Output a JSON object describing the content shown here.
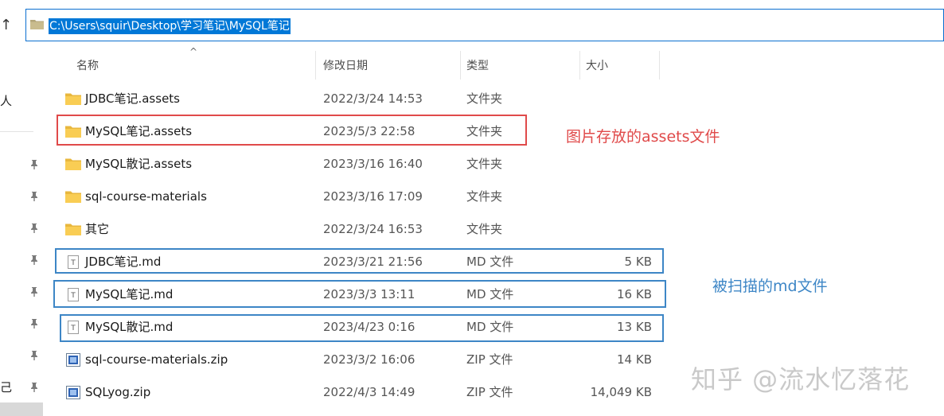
{
  "address_bar": {
    "path": "C:\\Users\\squir\\Desktop\\学习笔记\\MySQL笔记"
  },
  "left_nav": {
    "label_top": "人",
    "label_bottom": "己"
  },
  "columns": {
    "name": "名称",
    "modified": "修改日期",
    "type": "类型",
    "size": "大小"
  },
  "files": [
    {
      "name": "JDBC笔记.assets",
      "modified": "2022/3/24 14:53",
      "type": "文件夹",
      "size": "",
      "icon": "folder-icon"
    },
    {
      "name": "MySQL笔记.assets",
      "modified": "2023/5/3 22:58",
      "type": "文件夹",
      "size": "",
      "icon": "folder-icon"
    },
    {
      "name": "MySQL散记.assets",
      "modified": "2023/3/16 16:40",
      "type": "文件夹",
      "size": "",
      "icon": "folder-icon"
    },
    {
      "name": "sql-course-materials",
      "modified": "2023/3/16 17:09",
      "type": "文件夹",
      "size": "",
      "icon": "folder-icon"
    },
    {
      "name": "其它",
      "modified": "2022/3/24 16:53",
      "type": "文件夹",
      "size": "",
      "icon": "folder-icon"
    },
    {
      "name": "JDBC笔记.md",
      "modified": "2023/3/21 21:56",
      "type": "MD 文件",
      "size": "5 KB",
      "icon": "text-file-icon"
    },
    {
      "name": "MySQL笔记.md",
      "modified": "2023/3/3 13:11",
      "type": "MD 文件",
      "size": "16 KB",
      "icon": "text-file-icon"
    },
    {
      "name": "MySQL散记.md",
      "modified": "2023/4/23 0:16",
      "type": "MD 文件",
      "size": "13 KB",
      "icon": "text-file-icon"
    },
    {
      "name": "sql-course-materials.zip",
      "modified": "2023/3/2 16:06",
      "type": "ZIP 文件",
      "size": "14 KB",
      "icon": "zip-file-icon"
    },
    {
      "name": "SQLyog.zip",
      "modified": "2022/4/3 14:49",
      "type": "ZIP 文件",
      "size": "14,049 KB",
      "icon": "zip-file-icon"
    }
  ],
  "annotations": {
    "red_note": "图片存放的assets文件",
    "blue_note": "被扫描的md文件",
    "red_color": "#e04a4a",
    "blue_color": "#3d86c6"
  },
  "watermark": "知乎 @流水忆落花"
}
